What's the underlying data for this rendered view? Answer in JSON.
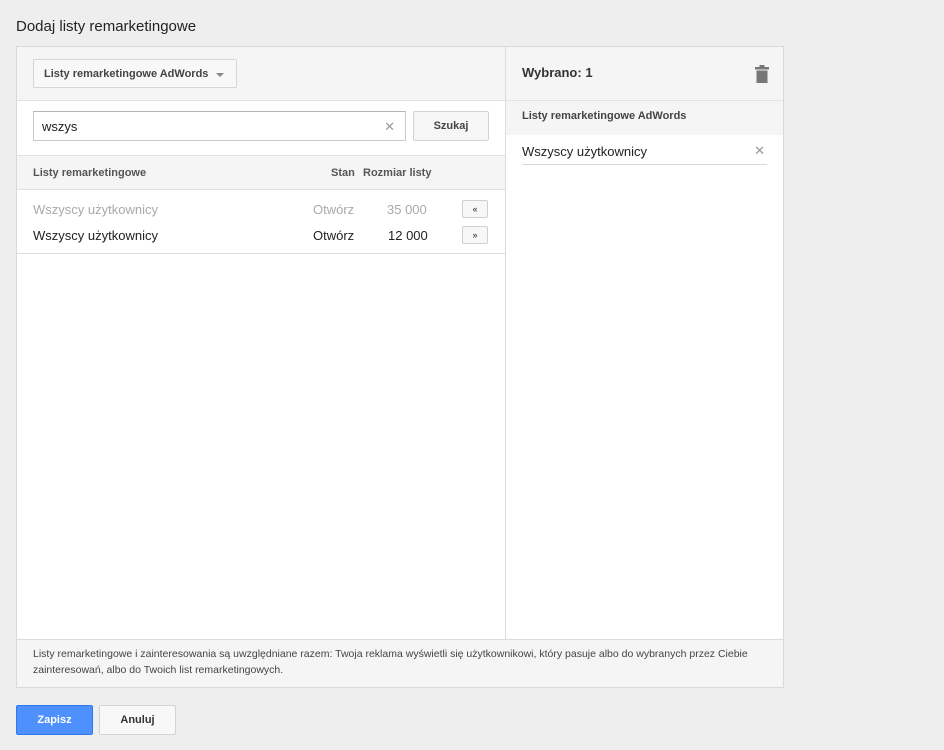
{
  "page": {
    "title": "Dodaj listy remarketingowe"
  },
  "left": {
    "source_dropdown": "Listy remarketingowe AdWords",
    "search": {
      "value": "wszys",
      "button": "Szukaj"
    },
    "columns": {
      "name": "Listy remarketingowe",
      "status": "Stan",
      "size": "Rozmiar listy"
    },
    "rows": [
      {
        "name": "Wszyscy użytkownicy",
        "status": "Otwórz",
        "size": "35 000",
        "action": "«",
        "added": true
      },
      {
        "name": "Wszyscy użytkownicy",
        "status": "Otwórz",
        "size": "12 000",
        "action": "»",
        "added": false
      }
    ]
  },
  "right": {
    "selected_label": "Wybrano: 1",
    "group_title": "Listy remarketingowe AdWords",
    "selected_items": [
      {
        "name": "Wszyscy użytkownicy"
      }
    ]
  },
  "footer_note": "Listy remarketingowe i zainteresowania są uwzględniane razem: Twoja reklama wyświetli się użytkownikowi, który pasuje albo do wybranych przez Ciebie zainteresowań, albo do Twoich list remarketingowych.",
  "actions": {
    "save": "Zapisz",
    "cancel": "Anuluj"
  },
  "colors": {
    "primary": "#4d90fe",
    "background": "#eeeeee",
    "muted_text": "#a9a9a9"
  },
  "icons": {
    "clear": "close-icon",
    "dropdown": "chevron-down-icon",
    "delete": "trash-icon",
    "remove": "close-icon"
  }
}
